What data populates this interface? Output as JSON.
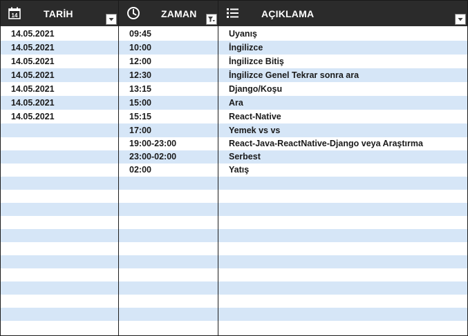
{
  "header": {
    "date_title": "TARİH",
    "time_title": "ZAMAN",
    "desc_title": "AÇIKLAMA",
    "date_icon_text": "14",
    "icons": {
      "date": "calendar-icon",
      "time": "clock-icon",
      "desc": "list-icon",
      "filter": "dropdown-arrow-icon",
      "filter_active": "filter-icon"
    }
  },
  "rows": [
    {
      "date": "14.05.2021",
      "time": "09:45",
      "desc": "Uyanış"
    },
    {
      "date": "14.05.2021",
      "time": "10:00",
      "desc": "İngilizce"
    },
    {
      "date": "14.05.2021",
      "time": "12:00",
      "desc": "İngilizce Bitiş"
    },
    {
      "date": "14.05.2021",
      "time": "12:30",
      "desc": "İngilizce Genel Tekrar sonra ara"
    },
    {
      "date": "14.05.2021",
      "time": "13:15",
      "desc": "Django/Koşu"
    },
    {
      "date": "14.05.2021",
      "time": "15:00",
      "desc": "Ara"
    },
    {
      "date": "14.05.2021",
      "time": "15:15",
      "desc": "React-Native"
    },
    {
      "date": "",
      "time": "17:00",
      "desc": "Yemek vs vs"
    },
    {
      "date": "",
      "time": "19:00-23:00",
      "desc": "React-Java-ReactNative-Django veya Araştırma"
    },
    {
      "date": "",
      "time": "23:00-02:00",
      "desc": "Serbest"
    },
    {
      "date": "",
      "time": "02:00",
      "desc": "Yatış"
    },
    {
      "date": "",
      "time": "",
      "desc": ""
    },
    {
      "date": "",
      "time": "",
      "desc": ""
    },
    {
      "date": "",
      "time": "",
      "desc": ""
    },
    {
      "date": "",
      "time": "",
      "desc": ""
    },
    {
      "date": "",
      "time": "",
      "desc": ""
    },
    {
      "date": "",
      "time": "",
      "desc": ""
    },
    {
      "date": "",
      "time": "",
      "desc": ""
    },
    {
      "date": "",
      "time": "",
      "desc": ""
    },
    {
      "date": "",
      "time": "",
      "desc": ""
    },
    {
      "date": "",
      "time": "",
      "desc": ""
    },
    {
      "date": "",
      "time": "",
      "desc": ""
    },
    {
      "date": "",
      "time": "",
      "desc": ""
    }
  ],
  "colors": {
    "header_bg": "#2b2b2b",
    "band": "#d6e6f7",
    "text": "#1a1a1a"
  }
}
